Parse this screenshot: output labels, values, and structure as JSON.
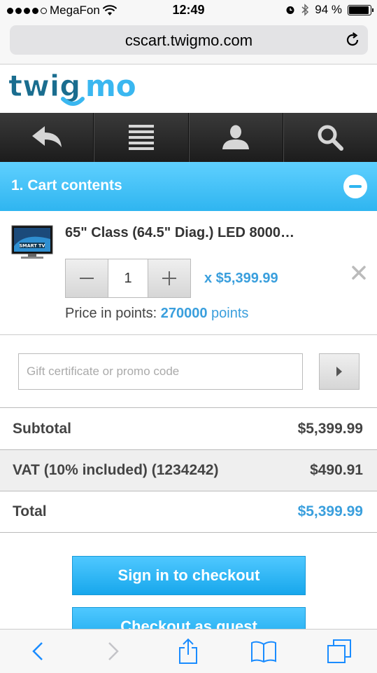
{
  "status_bar": {
    "carrier": "MegaFon",
    "time": "12:49",
    "battery": "94 %",
    "battery_level": 0.94
  },
  "browser": {
    "url": "cscart.twigmo.com"
  },
  "brand": {
    "logo_text": "twigmo",
    "logo_color": "#1a6d8f",
    "accent_color": "#3ab7f0"
  },
  "nav": {
    "icons": [
      "back-arrow-icon",
      "menu-list-icon",
      "user-icon",
      "search-icon"
    ]
  },
  "cart": {
    "section_title": "1. Cart contents",
    "product": {
      "name": "65\" Class (64.5\" Diag.) LED 8000…",
      "quantity": "1",
      "price": "x $5,399.99",
      "points_label": "Price in points:",
      "points_value": "270000",
      "points_unit": "points"
    }
  },
  "promo": {
    "placeholder": "Gift certificate or promo code"
  },
  "totals": {
    "subtotal_label": "Subtotal",
    "subtotal_value": "$5,399.99",
    "vat_label": "VAT (10% included) (1234242)",
    "vat_value": "$490.91",
    "total_label": "Total",
    "total_value": "$5,399.99"
  },
  "checkout": {
    "sign_in_label": "Sign in to checkout",
    "guest_label": "Checkout as guest"
  },
  "safari_toolbar": {
    "icons": [
      "back-icon",
      "forward-icon",
      "share-icon",
      "bookmarks-icon",
      "tabs-icon"
    ]
  }
}
